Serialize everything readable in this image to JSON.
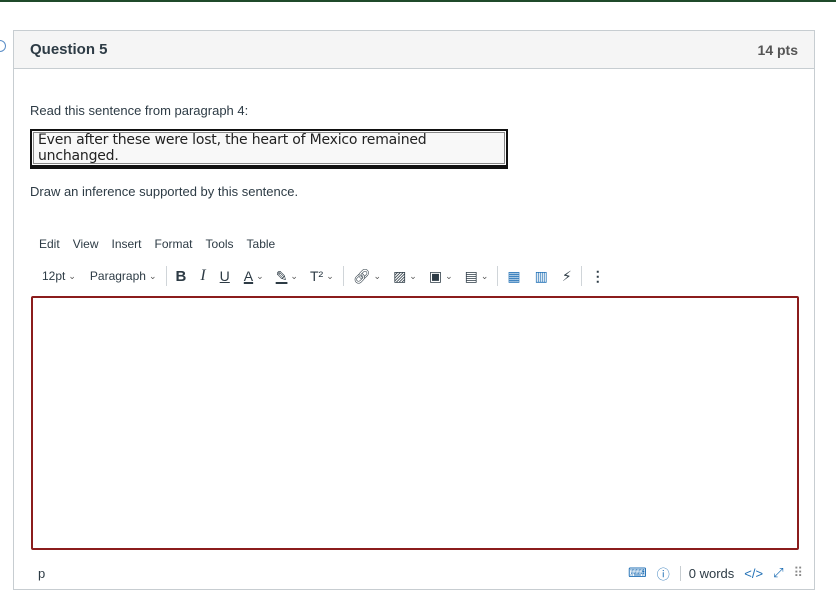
{
  "question": {
    "title": "Question 5",
    "points": "14 pts",
    "prompt": "Read this sentence from paragraph 4:",
    "quote": "Even after these were lost, the heart of Mexico remained unchanged.",
    "instruction": "Draw an inference supported by this sentence."
  },
  "editor": {
    "menus": [
      "Edit",
      "View",
      "Insert",
      "Format",
      "Tools",
      "Table"
    ],
    "font_size": "12pt",
    "block_format": "Paragraph",
    "content": "",
    "status_path": "p",
    "word_count": "0 words",
    "html_toggle": "</>",
    "accent_color": "#8b1c1c",
    "link_color": "#1f6fb5"
  }
}
